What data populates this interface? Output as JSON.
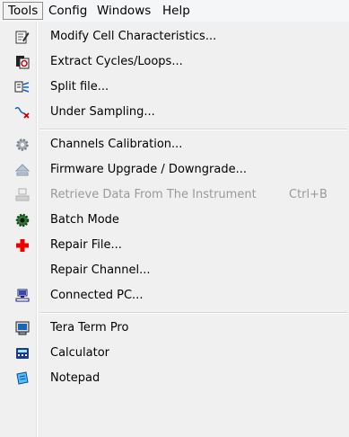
{
  "menubar": {
    "items": [
      {
        "label": "Tools"
      },
      {
        "label": "Config"
      },
      {
        "label": "Windows"
      },
      {
        "label": "Help"
      }
    ]
  },
  "tools_menu": {
    "items": [
      {
        "label": "Modify Cell Characteristics...",
        "icon": "edit-cell-icon"
      },
      {
        "label": "Extract Cycles/Loops...",
        "icon": "extract-cycles-icon"
      },
      {
        "label": "Split file...",
        "icon": "split-file-icon"
      },
      {
        "label": "Under Sampling...",
        "icon": "under-sampling-icon"
      },
      {
        "label": "Channels Calibration...",
        "icon": "calibration-gear-icon"
      },
      {
        "label": "Firmware Upgrade / Downgrade...",
        "icon": "firmware-upgrade-icon"
      },
      {
        "label": "Retrieve Data From The Instrument",
        "shortcut": "Ctrl+B",
        "icon": "retrieve-data-icon",
        "disabled": true
      },
      {
        "label": "Batch Mode",
        "icon": "batch-mode-icon"
      },
      {
        "label": "Repair File...",
        "icon": "red-cross-icon"
      },
      {
        "label": "Repair Channel..."
      },
      {
        "label": "Connected PC...",
        "icon": "connected-pc-icon"
      },
      {
        "label": "Tera Term Pro",
        "icon": "terminal-icon"
      },
      {
        "label": "Calculator",
        "icon": "calculator-icon"
      },
      {
        "label": "Notepad",
        "icon": "notepad-icon"
      }
    ]
  }
}
